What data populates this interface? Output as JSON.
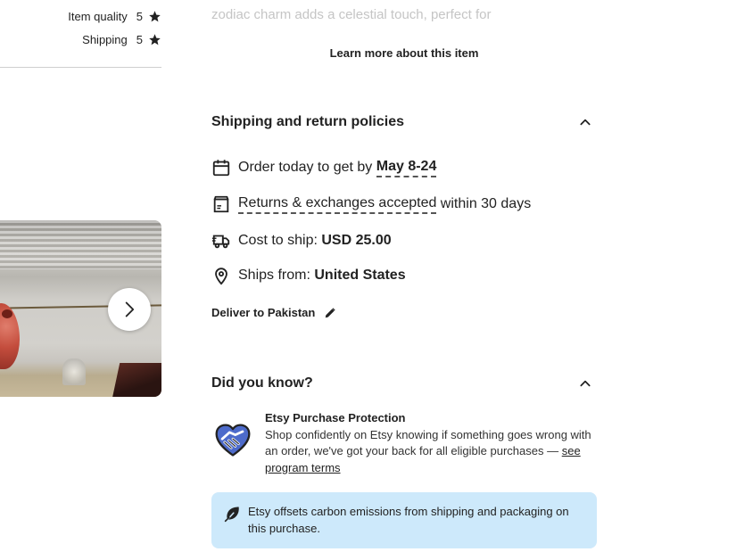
{
  "ratings": [
    {
      "label": "Item quality",
      "value": "5"
    },
    {
      "label": "Shipping",
      "value": "5"
    }
  ],
  "description": {
    "fade_text": "zodiac charm adds a celestial touch, perfect for",
    "learn_more": "Learn more about this item"
  },
  "shipping": {
    "title": "Shipping and return policies",
    "order_prefix": "Order today to get by ",
    "order_date": "May 8-24",
    "returns_link": "Returns & exchanges accepted",
    "returns_suffix": " within 30 days",
    "cost_prefix": "Cost to ship: ",
    "cost_value": "USD 25.00",
    "ships_prefix": "Ships from: ",
    "ships_value": "United States",
    "deliver_to": "Deliver to Pakistan"
  },
  "did_you_know": {
    "title": "Did you know?",
    "protection_title": "Etsy Purchase Protection",
    "protection_body": "Shop confidently on Etsy knowing if something goes wrong with an order, we've got your back for all eligible purchases — ",
    "protection_link": "see program terms",
    "carbon_text": "Etsy offsets carbon emissions from shipping and packaging on this purchase."
  },
  "icons": {
    "star": "star-icon",
    "next": "chevron-right-icon",
    "collapse": "chevron-up-icon",
    "calendar": "calendar-icon",
    "returns": "box-icon",
    "truck": "truck-icon",
    "location": "location-pin-icon",
    "edit": "pencil-icon",
    "protection": "handshake-icon",
    "carbon": "leaf-icon"
  },
  "colors": {
    "carbon_box_bg": "#cde9fb",
    "handshake_accent": "#4d6bcb"
  }
}
